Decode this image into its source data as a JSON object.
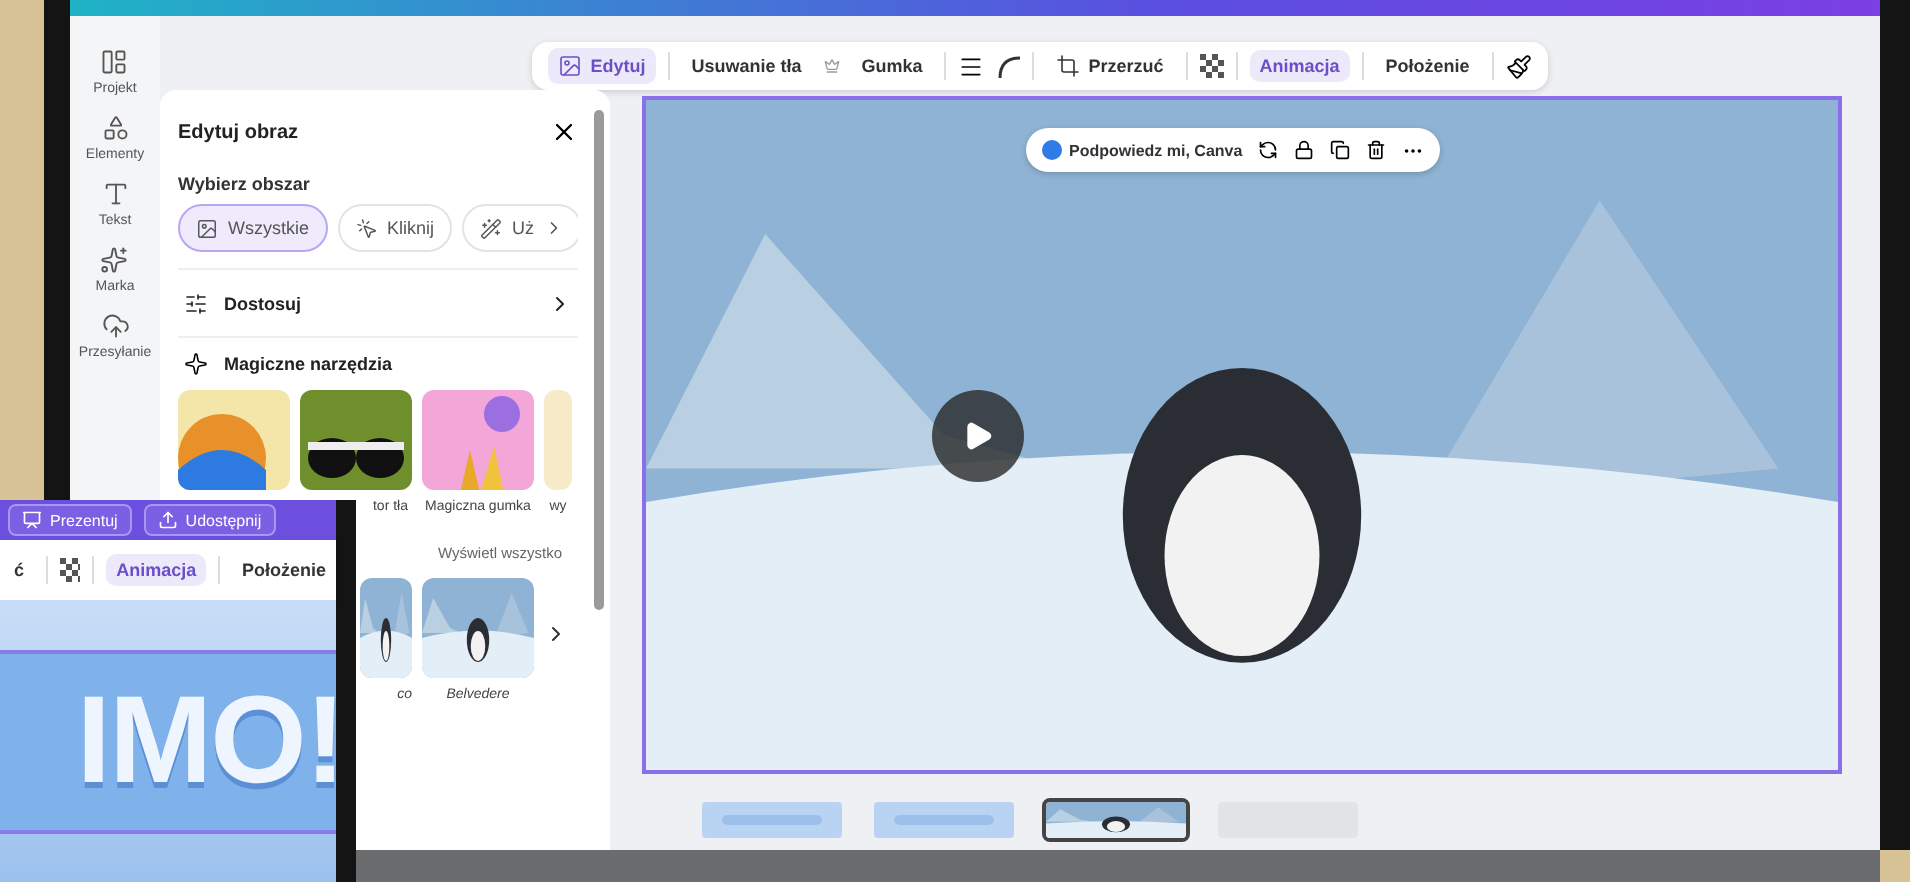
{
  "rail": [
    {
      "label": "Projekt"
    },
    {
      "label": "Elementy"
    },
    {
      "label": "Tekst"
    },
    {
      "label": "Marka"
    },
    {
      "label": "Przesyłanie"
    }
  ],
  "toolbar": [
    {
      "label": "Edytuj",
      "selected": true
    },
    {
      "label": "Usuwanie tła",
      "selected": false
    },
    {
      "label": "Gumka",
      "selected": false
    },
    {
      "label": "Przerzuć",
      "selected": false
    },
    {
      "label": "Animacja",
      "selected": true
    },
    {
      "label": "Położenie",
      "selected": false
    }
  ],
  "panel": {
    "title": "Edytuj obraz",
    "area_label": "Wybierz obszar",
    "chips": [
      {
        "label": "Wszystkie",
        "selected": true
      },
      {
        "label": "Kliknij",
        "selected": false
      },
      {
        "label": "Uż",
        "selected": false
      }
    ],
    "adjust": "Dostosuj",
    "magic_title": "Magiczne narzędzia",
    "tools": [
      {
        "label": "tor tła"
      },
      {
        "label": "Magiczna gumka"
      },
      {
        "label": "wy"
      }
    ],
    "see_all": "Wyświetl wszystko",
    "styles": [
      {
        "label": "co"
      },
      {
        "label": "Belvedere"
      }
    ]
  },
  "assistant": {
    "label": "Podpowiedz mi, Canva"
  },
  "pages": [
    {
      "selected": false
    },
    {
      "selected": false
    },
    {
      "selected": true
    },
    {
      "selected": false
    }
  ],
  "overlay": {
    "buttons": [
      "Prezentuj",
      "Udostępnij"
    ],
    "toolbar": [
      {
        "label": "ć",
        "selected": false
      },
      {
        "label": "Animacja",
        "selected": true
      },
      {
        "label": "Położenie",
        "selected": false
      }
    ],
    "banner_text": "IMO!"
  }
}
